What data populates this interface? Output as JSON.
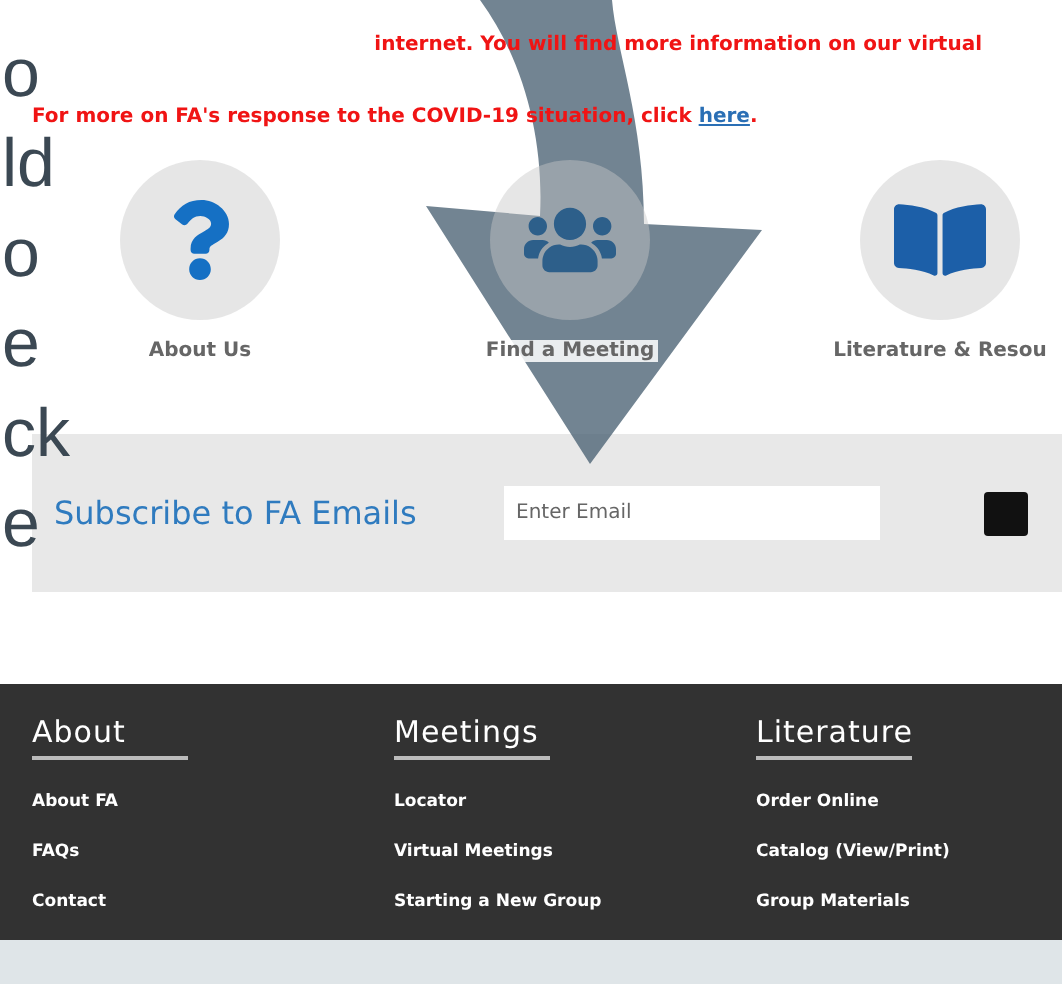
{
  "overlay_text": [
    "o",
    "ld",
    "o",
    "e",
    "ck",
    "e"
  ],
  "notice_partial": "internet. You will find more information on our virtual",
  "covid_notice": {
    "text": "For more on FA's response to the COVID-19 situation, click ",
    "link": "here",
    "after": "."
  },
  "quick_links": [
    {
      "label": "About Us",
      "kind": "question"
    },
    {
      "label": "Find a Meeting",
      "kind": "people"
    },
    {
      "label": "Literature & Resou",
      "kind": "book"
    }
  ],
  "subscribe": {
    "title": "Subscribe to FA Emails",
    "placeholder": "Enter Email"
  },
  "footer": {
    "columns": [
      {
        "heading": "About",
        "links": [
          "About FA",
          "FAQs",
          "Contact"
        ]
      },
      {
        "heading": "Meetings",
        "links": [
          "Locator",
          "Virtual Meetings",
          "Starting a New Group"
        ]
      },
      {
        "heading": "Literature",
        "links": [
          "Order Online",
          "Catalog (View/Print)",
          "Group Materials"
        ]
      }
    ]
  }
}
